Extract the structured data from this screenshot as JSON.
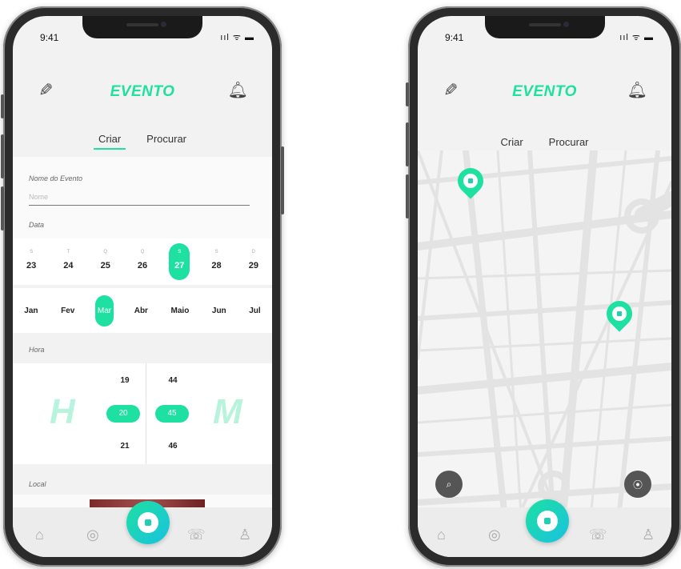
{
  "status": {
    "time": "9:41",
    "icons": "ııl ᯤ ▬"
  },
  "brand": "EVENTO",
  "tabs": {
    "create": "Criar",
    "search": "Procurar"
  },
  "form": {
    "event_name_label": "Nome do Evento",
    "event_name_placeholder": "Nome",
    "date_label": "Data",
    "hour_label": "Hora",
    "local_label": "Local"
  },
  "days": [
    {
      "letter": "S",
      "num": "23"
    },
    {
      "letter": "T",
      "num": "24"
    },
    {
      "letter": "Q",
      "num": "25"
    },
    {
      "letter": "Q",
      "num": "26"
    },
    {
      "letter": "S",
      "num": "27",
      "selected": true
    },
    {
      "letter": "S",
      "num": "28"
    },
    {
      "letter": "D",
      "num": "29"
    }
  ],
  "months": [
    "Jan",
    "Fev",
    "Mar",
    "Abr",
    "Maio",
    "Jun",
    "Jul"
  ],
  "selected_month": "Mar",
  "time_picker": {
    "h_letter": "H",
    "m_letter": "M",
    "hours": [
      "19",
      "20",
      "21"
    ],
    "minutes": [
      "44",
      "45",
      "46"
    ],
    "selected_hour": "20",
    "selected_minute": "45"
  },
  "icons": {
    "edit": "pencil-icon",
    "notify": "bell-icon",
    "home": "home-icon",
    "events": "ball-outline-icon",
    "fab": "soccer-ball-icon",
    "chat": "chat-icon",
    "profile": "user-icon",
    "map_search": "search-icon",
    "map_locate": "location-pin-icon"
  },
  "colors": {
    "accent": "#1ee0a0",
    "accent2": "#19c2e0"
  }
}
